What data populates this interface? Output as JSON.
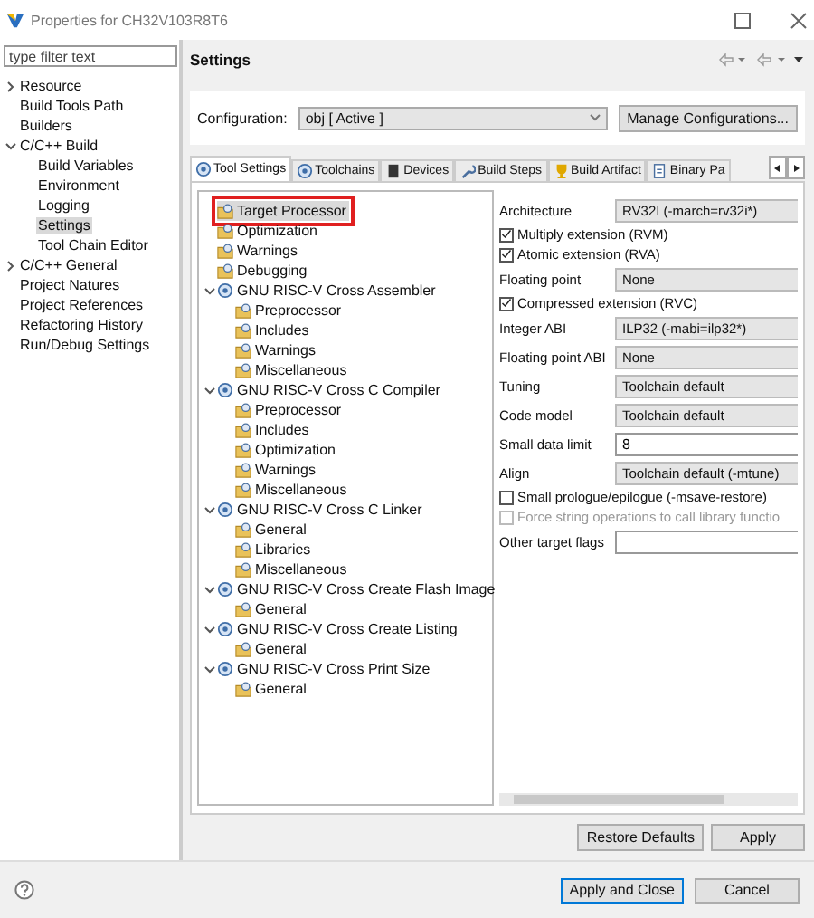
{
  "window": {
    "title": "Properties for CH32V103R8T6"
  },
  "sidebar": {
    "filter": {
      "placeholder": "type filter text"
    },
    "items": [
      {
        "label": "Resource",
        "selected": false,
        "expanded": false
      },
      {
        "label": "Build Tools Path",
        "selected": false
      },
      {
        "label": "Builders",
        "selected": false
      },
      {
        "label": "C/C++ Build",
        "selected": false,
        "expanded": true,
        "children": [
          {
            "label": "Build Variables",
            "selected": false
          },
          {
            "label": "Environment",
            "selected": false
          },
          {
            "label": "Logging",
            "selected": false
          },
          {
            "label": "Settings",
            "selected": true
          },
          {
            "label": "Tool Chain Editor",
            "selected": false
          }
        ]
      },
      {
        "label": "C/C++ General",
        "selected": false,
        "expanded": false
      },
      {
        "label": "Project Natures",
        "selected": false
      },
      {
        "label": "Project References",
        "selected": false
      },
      {
        "label": "Refactoring History",
        "selected": false
      },
      {
        "label": "Run/Debug Settings",
        "selected": false
      }
    ]
  },
  "page": {
    "title": "Settings"
  },
  "configuration": {
    "label": "Configuration:",
    "value": "obj  [ Active ]",
    "button": "Manage Configurations..."
  },
  "tabs": [
    {
      "label": "Tool Settings",
      "selected": true
    },
    {
      "label": "Toolchains",
      "selected": false
    },
    {
      "label": "Devices",
      "selected": false
    },
    {
      "label": "Build Steps",
      "selected": false
    },
    {
      "label": "Build Artifact",
      "selected": false
    },
    {
      "label": "Binary Pa",
      "selected": false
    }
  ],
  "tree": [
    {
      "label": "Target Processor",
      "kind": "option",
      "selected": true,
      "marked": true
    },
    {
      "label": "Optimization",
      "kind": "option",
      "selected": false,
      "marked": false
    },
    {
      "label": "Warnings",
      "kind": "option",
      "selected": false,
      "marked": false
    },
    {
      "label": "Debugging",
      "kind": "option",
      "selected": false,
      "marked": false
    },
    {
      "label": "GNU RISC-V Cross Assembler",
      "kind": "tool",
      "selected": false,
      "marked": false,
      "expanded": true,
      "children": [
        {
          "label": "Preprocessor",
          "kind": "option",
          "selected": false,
          "marked": false
        },
        {
          "label": "Includes",
          "kind": "option",
          "selected": false,
          "marked": false
        },
        {
          "label": "Warnings",
          "kind": "option",
          "selected": false,
          "marked": false
        },
        {
          "label": "Miscellaneous",
          "kind": "option",
          "selected": false,
          "marked": false
        }
      ]
    },
    {
      "label": "GNU RISC-V Cross C Compiler",
      "kind": "tool",
      "selected": false,
      "marked": false,
      "expanded": true,
      "children": [
        {
          "label": "Preprocessor",
          "kind": "option",
          "selected": false,
          "marked": false
        },
        {
          "label": "Includes",
          "kind": "option",
          "selected": false,
          "marked": false
        },
        {
          "label": "Optimization",
          "kind": "option",
          "selected": false,
          "marked": false
        },
        {
          "label": "Warnings",
          "kind": "option",
          "selected": false,
          "marked": false
        },
        {
          "label": "Miscellaneous",
          "kind": "option",
          "selected": false,
          "marked": false
        }
      ]
    },
    {
      "label": "GNU RISC-V Cross C Linker",
      "kind": "tool",
      "selected": false,
      "marked": false,
      "expanded": true,
      "children": [
        {
          "label": "General",
          "kind": "option",
          "selected": false,
          "marked": false
        },
        {
          "label": "Libraries",
          "kind": "option",
          "selected": false,
          "marked": false
        },
        {
          "label": "Miscellaneous",
          "kind": "option",
          "selected": false,
          "marked": false
        }
      ]
    },
    {
      "label": "GNU RISC-V Cross Create Flash Image",
      "kind": "tool",
      "selected": false,
      "marked": false,
      "expanded": true,
      "children": [
        {
          "label": "General",
          "kind": "option",
          "selected": false,
          "marked": false
        }
      ]
    },
    {
      "label": "GNU RISC-V Cross Create Listing",
      "kind": "tool",
      "selected": false,
      "marked": false,
      "expanded": true,
      "children": [
        {
          "label": "General",
          "kind": "option",
          "selected": false,
          "marked": false
        }
      ]
    },
    {
      "label": "GNU RISC-V Cross Print Size",
      "kind": "tool",
      "selected": false,
      "marked": false,
      "expanded": true,
      "children": [
        {
          "label": "General",
          "kind": "option",
          "selected": false,
          "marked": false
        }
      ]
    }
  ],
  "options": [
    {
      "kind": "select",
      "label": "Architecture",
      "value": "RV32I (-march=rv32i*)"
    },
    {
      "kind": "check",
      "label": "Multiply extension (RVM)",
      "checked": true,
      "disabled": false
    },
    {
      "kind": "check",
      "label": "Atomic extension (RVA)",
      "checked": true,
      "disabled": false
    },
    {
      "kind": "select",
      "label": "Floating point",
      "value": "None"
    },
    {
      "kind": "check",
      "label": "Compressed extension (RVC)",
      "checked": true,
      "disabled": false
    },
    {
      "kind": "select",
      "label": "Integer ABI",
      "value": "ILP32 (-mabi=ilp32*)"
    },
    {
      "kind": "select",
      "label": "Floating point ABI",
      "value": "None"
    },
    {
      "kind": "select",
      "label": "Tuning",
      "value": "Toolchain default"
    },
    {
      "kind": "select",
      "label": "Code model",
      "value": "Toolchain default"
    },
    {
      "kind": "text",
      "label": "Small data limit",
      "value": "8"
    },
    {
      "kind": "select",
      "label": "Align",
      "value": "Toolchain default (-mtune)"
    },
    {
      "kind": "check",
      "label": "Small prologue/epilogue (-msave-restore)",
      "checked": false,
      "disabled": false
    },
    {
      "kind": "check",
      "label": "Force string operations to call library functio",
      "checked": false,
      "disabled": true
    },
    {
      "kind": "text",
      "label": "Other target flags"
    }
  ],
  "page_buttons": [
    "Restore Defaults",
    "Apply"
  ],
  "dialog_buttons": [
    {
      "label": "Apply and Close",
      "default": true
    },
    {
      "label": "Cancel",
      "default": false
    }
  ]
}
